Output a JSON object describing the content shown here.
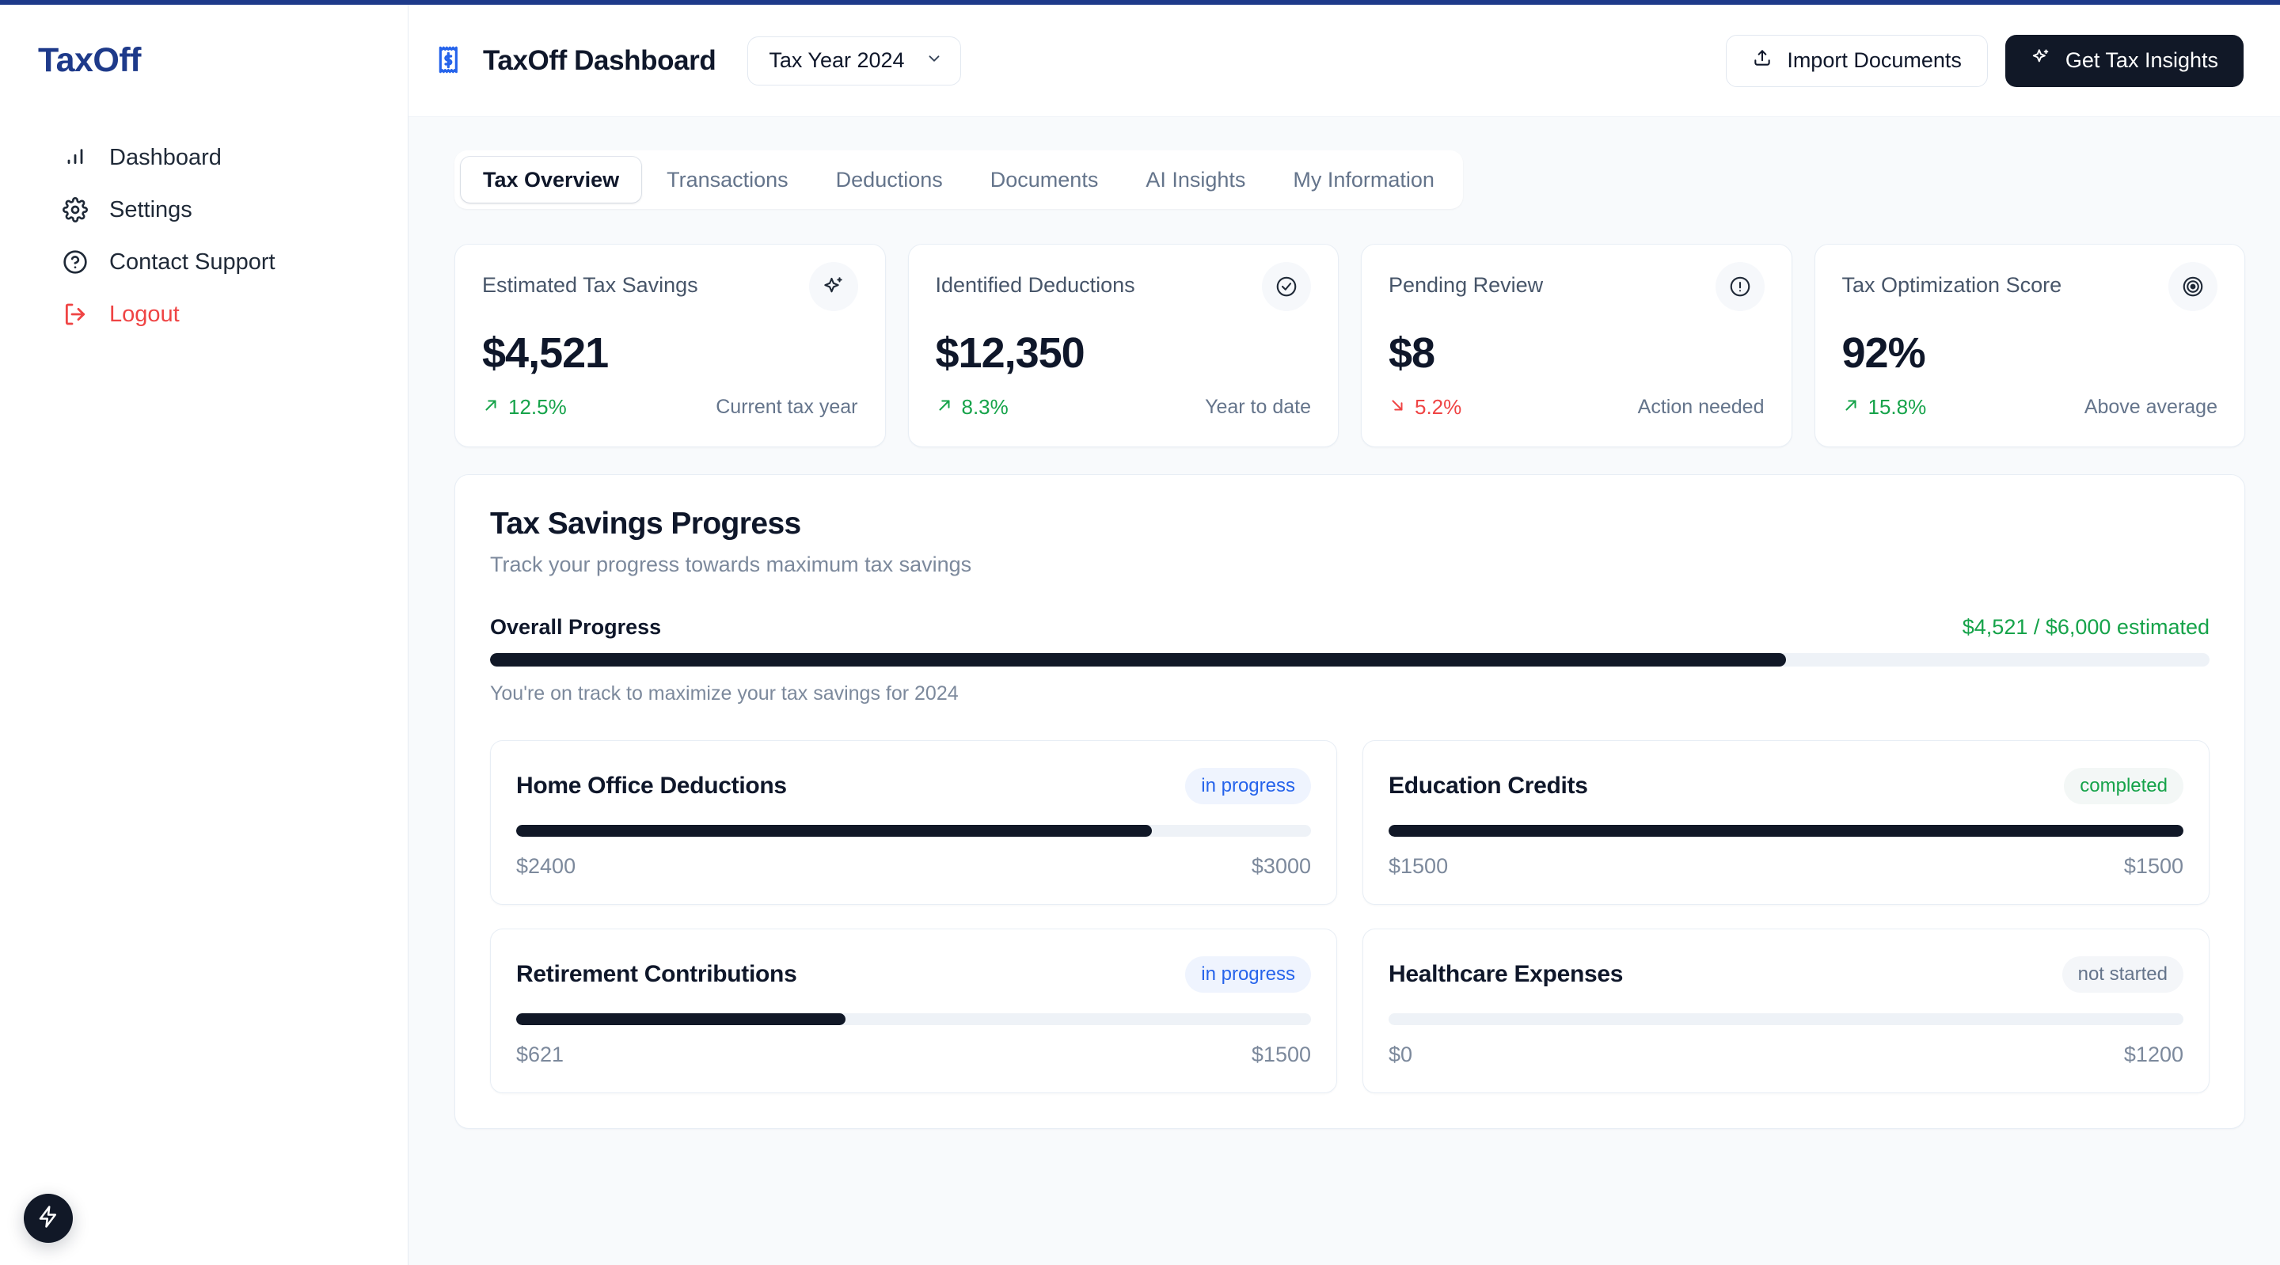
{
  "theme": {
    "brand_blue": "#1e3a8a",
    "accent_blue": "#2563eb",
    "dark": "#111827",
    "green": "#16a34a",
    "red": "#ef4444",
    "page_bg": "#f8fafc"
  },
  "sidebar": {
    "brand": "TaxOff",
    "items": [
      {
        "label": "Dashboard",
        "icon": "bar-chart-icon"
      },
      {
        "label": "Settings",
        "icon": "gear-icon"
      },
      {
        "label": "Contact Support",
        "icon": "help-circle-icon"
      },
      {
        "label": "Logout",
        "icon": "logout-icon"
      }
    ]
  },
  "topbar": {
    "logo_icon": "receipt-dollar-icon",
    "title": "TaxOff Dashboard",
    "year_select": {
      "value": "Tax Year 2024",
      "icon": "chevron-down-icon"
    },
    "import_button": {
      "label": "Import Documents",
      "icon": "upload-icon"
    },
    "insights_button": {
      "label": "Get Tax Insights",
      "icon": "sparkles-icon"
    }
  },
  "tabs": [
    {
      "label": "Tax Overview",
      "active": true
    },
    {
      "label": "Transactions",
      "active": false
    },
    {
      "label": "Deductions",
      "active": false
    },
    {
      "label": "Documents",
      "active": false
    },
    {
      "label": "AI Insights",
      "active": false
    },
    {
      "label": "My Information",
      "active": false
    }
  ],
  "kpis": [
    {
      "title": "Estimated Tax Savings",
      "value": "$4,521",
      "delta": "12.5%",
      "direction": "up",
      "note": "Current tax year",
      "icon": "sparkles-icon"
    },
    {
      "title": "Identified Deductions",
      "value": "$12,350",
      "delta": "8.3%",
      "direction": "up",
      "note": "Year to date",
      "icon": "check-circle-icon"
    },
    {
      "title": "Pending Review",
      "value": "$8",
      "delta": "5.2%",
      "direction": "down",
      "note": "Action needed",
      "icon": "alert-circle-icon"
    },
    {
      "title": "Tax Optimization Score",
      "value": "92%",
      "delta": "15.8%",
      "direction": "up",
      "note": "Above average",
      "icon": "target-icon"
    }
  ],
  "progress_panel": {
    "title": "Tax Savings Progress",
    "subtitle": "Track your progress towards maximum tax savings",
    "overall_label": "Overall Progress",
    "overall_value": "$4,521 / $6,000 estimated",
    "overall_percent": 75.35,
    "overall_note": "You're on track to maximize your tax savings for 2024",
    "items": [
      {
        "name": "Home Office Deductions",
        "status": "in progress",
        "status_class": "in-progress",
        "current": "$2400",
        "target": "$3000",
        "percent": 80
      },
      {
        "name": "Education Credits",
        "status": "completed",
        "status_class": "completed",
        "current": "$1500",
        "target": "$1500",
        "percent": 100
      },
      {
        "name": "Retirement Contributions",
        "status": "in progress",
        "status_class": "in-progress",
        "current": "$621",
        "target": "$1500",
        "percent": 41.4
      },
      {
        "name": "Healthcare Expenses",
        "status": "not started",
        "status_class": "not-started",
        "current": "$0",
        "target": "$1200",
        "percent": 0
      }
    ]
  },
  "fab": {
    "icon": "lightning-bolt-icon"
  }
}
